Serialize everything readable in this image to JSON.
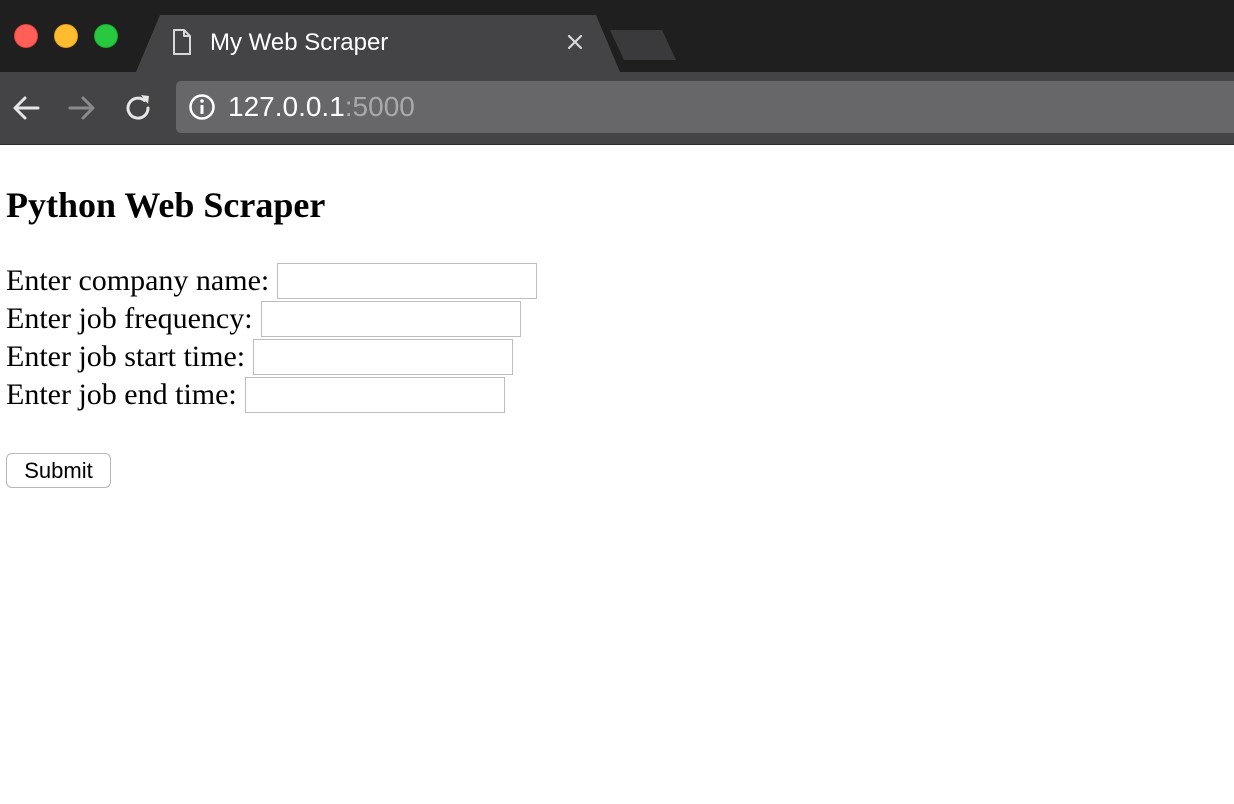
{
  "browser": {
    "tab": {
      "title": "My Web Scraper",
      "icon": "document-icon",
      "close_icon": "close-icon"
    },
    "new_tab_icon": "new-tab-icon",
    "nav": {
      "back_icon": "back-arrow-icon",
      "forward_icon": "forward-arrow-icon",
      "reload_icon": "reload-icon"
    },
    "address_bar": {
      "info_icon": "info-icon",
      "host": "127.0.0.1",
      "port": ":5000"
    }
  },
  "page": {
    "title": "Python Web Scraper",
    "form": {
      "fields": [
        {
          "label": "Enter company name:",
          "value": ""
        },
        {
          "label": "Enter job frequency:",
          "value": ""
        },
        {
          "label": "Enter job start time:",
          "value": ""
        },
        {
          "label": "Enter job end time:",
          "value": ""
        }
      ],
      "submit_label": "Submit"
    }
  },
  "colors": {
    "tab_bar": "#1f1f20",
    "toolbar": "#444446",
    "omnibox": "#676769",
    "traffic_red": "#ff5f57",
    "traffic_yellow": "#febc2e",
    "traffic_green": "#28c840"
  }
}
